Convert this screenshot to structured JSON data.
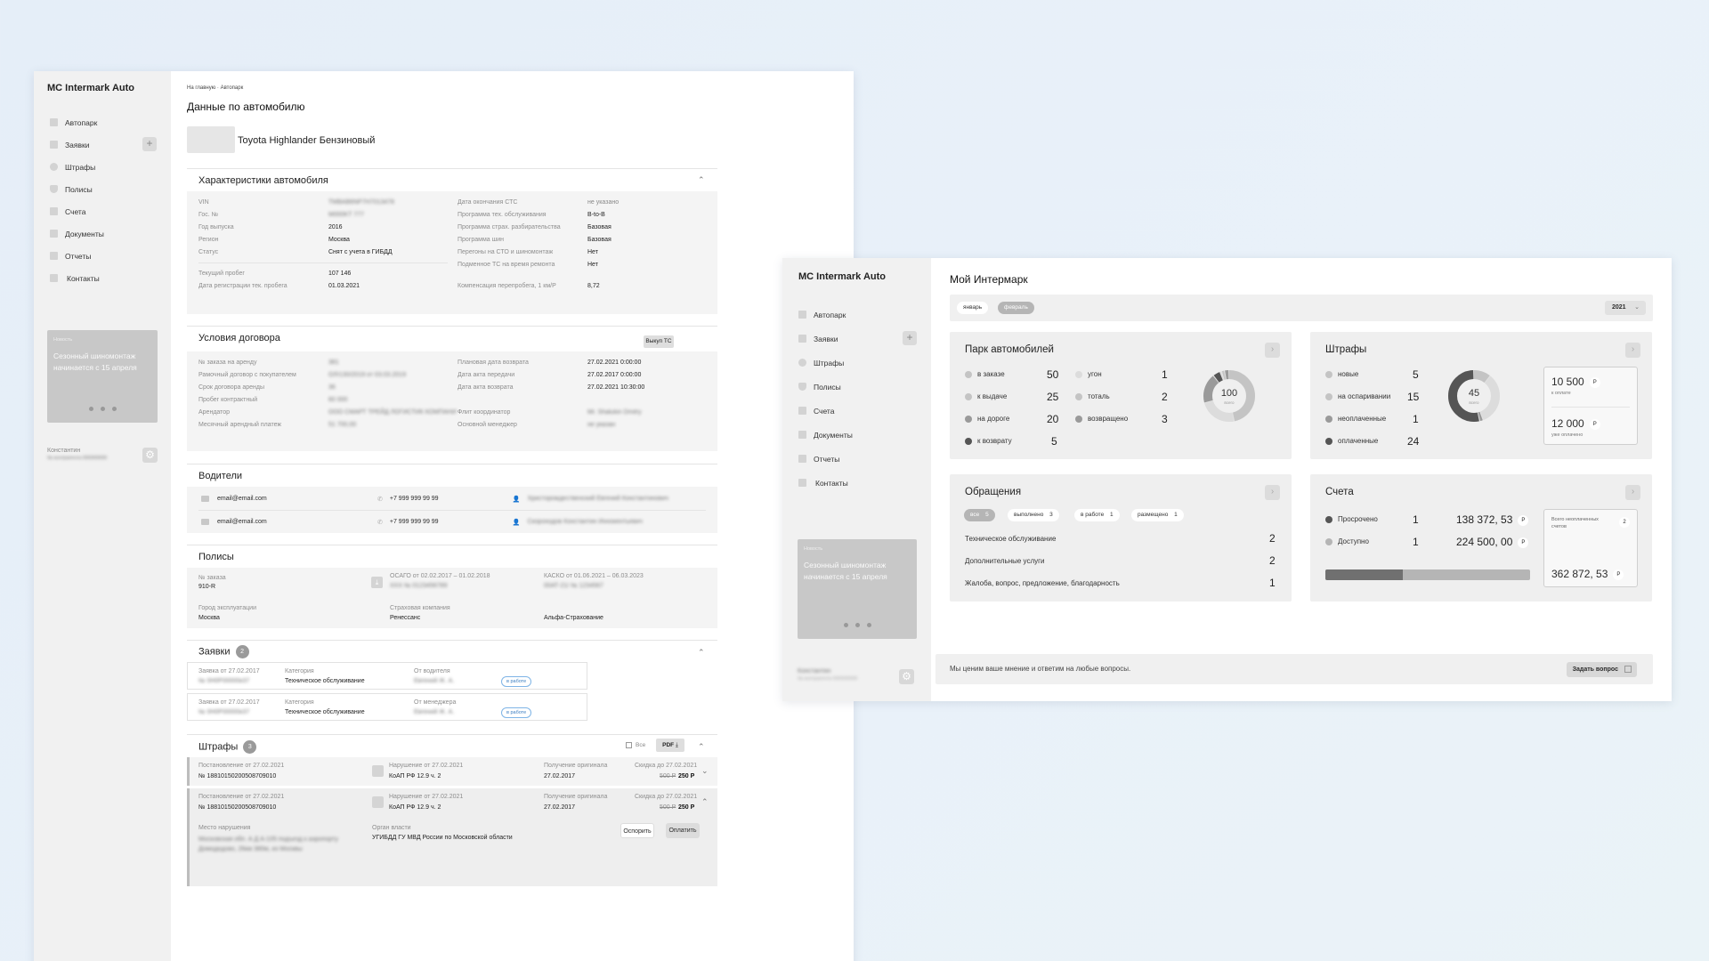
{
  "left": {
    "logo": "MC Intermark Auto",
    "nav": [
      "Автопарк",
      "Заявки",
      "Штрафы",
      "Полисы",
      "Счета",
      "Документы",
      "Отчеты",
      "Контакты"
    ],
    "promo": {
      "tag": "Новость",
      "text": "Сезонный шиномонтаж начинается с 15 апреля"
    },
    "user": {
      "name": "Константин",
      "contract": "№ контрагента 000000000"
    },
    "breadcrumb": {
      "home": "На главную",
      "sep": "·",
      "current": "Автопарк"
    },
    "title": "Данные по автомобилю",
    "car_name": "Toyota Highlander Бензиновый",
    "specs": {
      "title": "Характеристики автомобиля",
      "left": [
        [
          "VIN",
          "TMBAB6NP7H7013478"
        ],
        [
          "Гос. №",
          "M000KT 777"
        ],
        [
          "Год выпуска",
          "2016"
        ],
        [
          "Регион",
          "Москва"
        ],
        [
          "Статус",
          "Снят с учета в ГИБДД"
        ]
      ],
      "left2": [
        [
          "Текущий пробег",
          "107 146"
        ],
        [
          "Дата регистрации тек. пробега",
          "01.03.2021"
        ]
      ],
      "right": [
        [
          "Дата окончания СТС",
          "не указано"
        ],
        [
          "Программа тех. обслуживания",
          "B-to-B"
        ],
        [
          "Программа страх. разбирательства",
          "Базовая"
        ],
        [
          "Программа шин",
          "Базовая"
        ],
        [
          "Перегоны на СТО и шиномонтаж",
          "Нет"
        ],
        [
          "Подменное ТС на время ремонта",
          "Нет"
        ],
        [
          "Компенсация перепробега, 1 км/Р",
          "8,72"
        ]
      ]
    },
    "contract": {
      "title": "Условия договора",
      "buyout": "Выкуп ТС",
      "left": [
        [
          "№ заказа на аренду",
          "381"
        ],
        [
          "Рамочный договор с покупателем",
          "ОЛ/130/2019 от 03.03.2019"
        ],
        [
          "Срок договора аренды",
          "36"
        ],
        [
          "Пробег контрактный",
          "60 000"
        ],
        [
          "Арендатор",
          "ООО СМАРТ ТРЕЙД ЛОГИСТИК КОМПАНИ"
        ],
        [
          "Месячный арендный платеж",
          "51 700,00"
        ]
      ],
      "right": [
        [
          "Плановая дата возврата",
          "27.02.2021 0:00:00"
        ],
        [
          "Дата акта передачи",
          "27.02.2017 0:00:00"
        ],
        [
          "Дата акта возврата",
          "27.02.2021 10:30:00"
        ],
        [
          "Флит координатор",
          "Mr. Shalukin Dmitry"
        ],
        [
          "Основной менеджер",
          "не указан"
        ]
      ]
    },
    "drivers": {
      "title": "Водители",
      "rows": [
        {
          "email": "email@email.com",
          "phone": "+7 999 999 99 99",
          "name": "Христорождественский Евгений Константинович"
        },
        {
          "email": "email@email.com",
          "phone": "+7 999 999 99 99",
          "name": "Скороходов Константин Иннокентьевич"
        }
      ]
    },
    "policies": {
      "title": "Полисы",
      "order_label": "№ заказа",
      "order": "910-R",
      "osago_label": "ОСАГО от 02.02.2017 – 01.02.2018",
      "osago_no": "XXX  № 0123456789",
      "kasko_label": "КАСКО от 01.06.2021 – 06.03.2023",
      "kasko_no": "00АТ-21/  № 1234567",
      "city_label": "Город эксплуатации",
      "city": "Москва",
      "ins_label": "Страховая компания",
      "ins1": "Ренессанс",
      "ins2": "Альфа-Страхование"
    },
    "requests": {
      "title": "Заявки",
      "count": "2",
      "rows": [
        {
          "date": "Заявка от 27.02.2017",
          "no": "№ 0Н0Р00000к37",
          "cat_label": "Категория",
          "cat": "Техническое обслуживание",
          "from_label": "От водителя",
          "from": "Евгений Ж. А.",
          "status": "в работе"
        },
        {
          "date": "Заявка от 27.02.2017",
          "no": "№ 0Н0Р00000к37",
          "cat_label": "Категория",
          "cat": "Техническое обслуживание",
          "from_label": "От менеджера",
          "from": "Евгений Ж. А.",
          "status": "в работе"
        }
      ]
    },
    "fines": {
      "title": "Штрафы",
      "count": "3",
      "all": "Все",
      "pdf": "PDF",
      "rows": [
        {
          "ruling": "Постановление от 27.02.2021",
          "no": "№ 18810150200508709010",
          "viol": "Нарушение от 27.02.2021",
          "koap": "КоАП РФ 12.9 ч. 2",
          "orig_label": "Получение оригинала",
          "orig": "27.02.2017",
          "disc_label": "Скидка до 27.02.2021",
          "old": "500 Р",
          "new": "250 Р"
        },
        {
          "ruling": "Постановление от 27.02.2021",
          "no": "№ 18810150200508709010",
          "viol": "Нарушение от 27.02.2021",
          "koap": "КоАП РФ 12.9 ч. 2",
          "orig_label": "Получение оригинала",
          "orig": "27.02.2017",
          "disc_label": "Скидка до 27.02.2021",
          "old": "500 Р",
          "new": "250 Р"
        }
      ],
      "place_label": "Место нарушения",
      "place": "Московская обл. А Д А-105 подъезд к аэропорту Домодедово, 26км 380м, из Москвы",
      "org_label": "Орган власти",
      "org": "УГИБДД ГУ МВД России по Московской области",
      "dispute": "Оспорить",
      "pay": "Оплатить"
    }
  },
  "right": {
    "logo": "MC Intermark Auto",
    "nav": [
      "Автопарк",
      "Заявки",
      "Штрафы",
      "Полисы",
      "Счета",
      "Документы",
      "Отчеты",
      "Контакты"
    ],
    "promo": {
      "tag": "Новость",
      "text": "Сезонный шиномонтаж начинается с 15 апреля"
    },
    "user": {
      "name": "Константин",
      "contract": "№ контрагента 000000000"
    },
    "title": "Мой Интермарк",
    "months": [
      "январь",
      "февраль"
    ],
    "year": "2021",
    "fleet": {
      "title": "Парк автомобилей",
      "items": [
        [
          "в заказе",
          "50"
        ],
        [
          "к выдаче",
          "25"
        ],
        [
          "на дороге",
          "20"
        ],
        [
          "к возврату",
          "5"
        ],
        [
          "угон",
          "1"
        ],
        [
          "тоталь",
          "2"
        ],
        [
          "возвращено",
          "3"
        ]
      ],
      "total": "100",
      "total_label": "всего"
    },
    "fines": {
      "title": "Штрафы",
      "items": [
        [
          "новые",
          "5"
        ],
        [
          "на оспаривании",
          "15"
        ],
        [
          "неоплаченные",
          "1"
        ],
        [
          "оплаченные",
          "24"
        ]
      ],
      "total": "45",
      "total_label": "всего",
      "to_pay": "10 500",
      "to_pay_label": "к оплате",
      "paid": "12 000",
      "paid_label": "уже оплачено",
      "cur": "Р"
    },
    "appeals": {
      "title": "Обращения",
      "chips": [
        [
          "все",
          "5"
        ],
        [
          "выполнено",
          "3"
        ],
        [
          "в работе",
          "1"
        ],
        [
          "размещено",
          "1"
        ]
      ],
      "rows": [
        [
          "Техническое обслуживание",
          "2"
        ],
        [
          "Дополнительные услуги",
          "2"
        ],
        [
          "Жалоба, вопрос, предложение, благодарность",
          "1"
        ]
      ]
    },
    "bills": {
      "title": "Счета",
      "rows": [
        [
          "Просрочено",
          "1",
          "138 372, 53"
        ],
        [
          "Доступно",
          "1",
          "224 500, 00"
        ]
      ],
      "unpaid_label": "Всего неоплаченных счетов",
      "unpaid_count": "2",
      "unpaid_sum": "362 872, 53",
      "cur": "Р",
      "overdue_share": 0.38
    },
    "footer": {
      "text": "Мы ценим ваше мнение и ответим на любые вопросы.",
      "button": "Задать вопрос"
    },
    "colors": {
      "dark": "#555555",
      "mid": "#9a9a9a",
      "light": "#c4c4c4",
      "vlight": "#dcdcdc"
    }
  }
}
